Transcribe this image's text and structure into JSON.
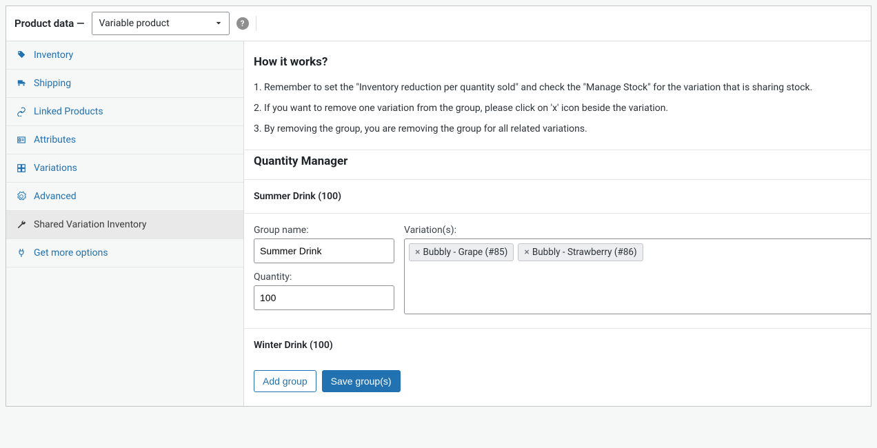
{
  "header": {
    "title": "Product data —",
    "product_type": "Variable product"
  },
  "sidebar": {
    "items": [
      {
        "label": "Inventory",
        "icon": "tag-icon",
        "active": false
      },
      {
        "label": "Shipping",
        "icon": "truck-icon",
        "active": false
      },
      {
        "label": "Linked Products",
        "icon": "link-icon",
        "active": false
      },
      {
        "label": "Attributes",
        "icon": "id-icon",
        "active": false
      },
      {
        "label": "Variations",
        "icon": "grid-icon",
        "active": false
      },
      {
        "label": "Advanced",
        "icon": "gear-icon",
        "active": false
      },
      {
        "label": "Shared Variation Inventory",
        "icon": "wrench-icon",
        "active": true
      },
      {
        "label": "Get more options",
        "icon": "plug-icon",
        "active": false
      }
    ]
  },
  "main": {
    "how_title": "How it works?",
    "steps": [
      "1. Remember to set the \"Inventory reduction per quantity sold\" and check the \"Manage Stock\" for the variation that is sharing stock.",
      "2. If you want to remove one variation from the group, please click on 'x' icon beside the variation.",
      "3. By removing the group, you are removing the group for all related variations."
    ],
    "qm_title": "Quantity Manager",
    "labels": {
      "group_name": "Group name:",
      "quantity": "Quantity:",
      "variations": "Variation(s):"
    },
    "groups": [
      {
        "title": "Summer Drink (100)",
        "name": "Summer Drink",
        "quantity": "100",
        "variations": [
          "Bubbly - Grape (#85)",
          "Bubbly - Strawberry (#86)"
        ],
        "expanded": true
      },
      {
        "title": "Winter Drink (100)",
        "expanded": false
      }
    ],
    "buttons": {
      "add_group": "Add group",
      "save_groups": "Save group(s)"
    }
  },
  "colors": {
    "link": "#2271b1",
    "primary": "#2271b1"
  }
}
